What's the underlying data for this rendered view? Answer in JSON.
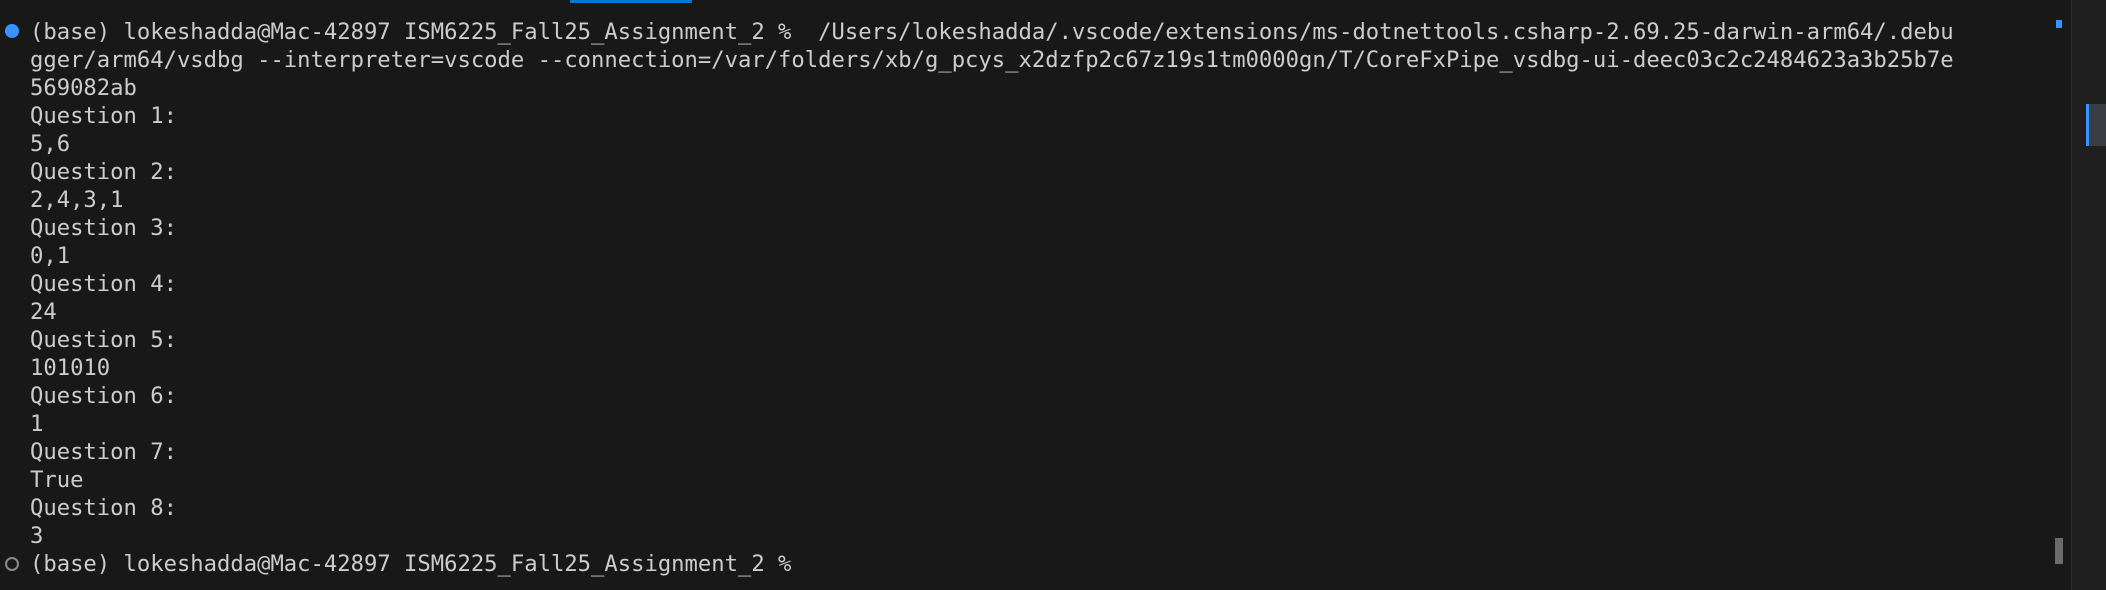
{
  "terminal": {
    "lines": [
      "(base) lokeshadda@Mac-42897 ISM6225_Fall25_Assignment_2 %  /Users/lokeshadda/.vscode/extensions/ms-dotnettools.csharp-2.69.25-darwin-arm64/.debu",
      "gger/arm64/vsdbg --interpreter=vscode --connection=/var/folders/xb/g_pcys_x2dzfp2c67z19s1tm0000gn/T/CoreFxPipe_vsdbg-ui-deec03c2c2484623a3b25b7e",
      "569082ab",
      "Question 1:",
      "5,6",
      "Question 2:",
      "2,4,3,1",
      "Question 3:",
      "0,1",
      "Question 4:",
      "24",
      "Question 5:",
      "101010",
      "Question 6:",
      "1",
      "Question 7:",
      "True",
      "Question 8:",
      "3",
      "(base) lokeshadda@Mac-42897 ISM6225_Fall25_Assignment_2 % "
    ]
  },
  "colors": {
    "background": "#181818",
    "foreground": "#cccccc",
    "accent": "#3794ff"
  }
}
